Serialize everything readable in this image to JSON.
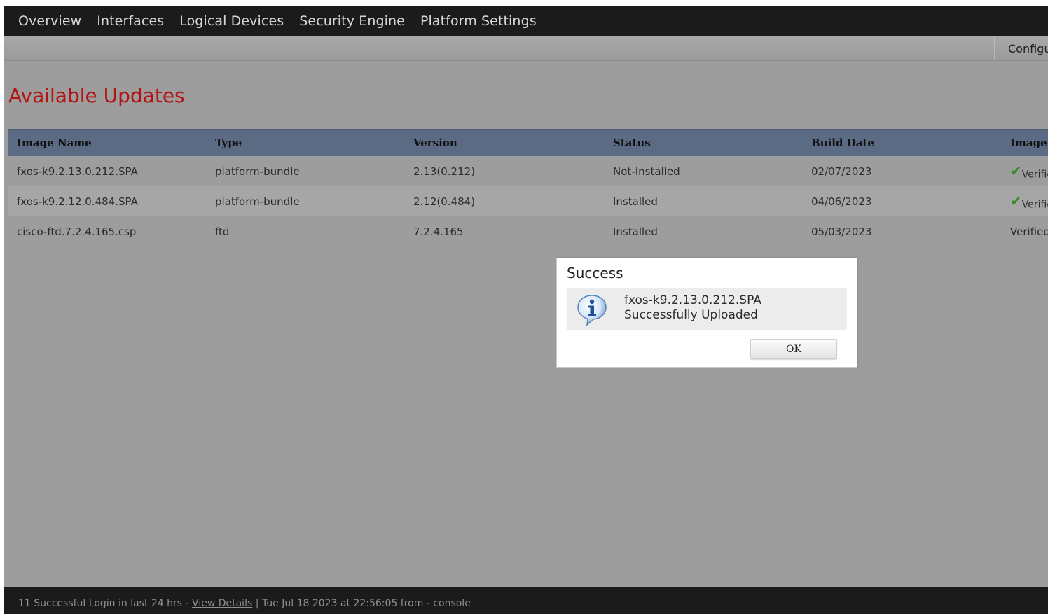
{
  "nav": {
    "items": [
      "Overview",
      "Interfaces",
      "Logical Devices",
      "Security Engine",
      "Platform Settings"
    ]
  },
  "subbar": {
    "config_label": "Configuration"
  },
  "page": {
    "title": "Available Updates"
  },
  "table": {
    "headers": [
      "Image Name",
      "Type",
      "Version",
      "Status",
      "Build Date",
      "Image Integrity"
    ],
    "rows": [
      {
        "image_name": "fxos-k9.2.13.0.212.SPA",
        "type": "platform-bundle",
        "version": "2.13(0.212)",
        "status": "Not-Installed",
        "build_date": "02/07/2023",
        "image_status": "Verified",
        "check": true
      },
      {
        "image_name": "fxos-k9.2.12.0.484.SPA",
        "type": "platform-bundle",
        "version": "2.12(0.484)",
        "status": "Installed",
        "build_date": "04/06/2023",
        "image_status": "Verified",
        "check": true
      },
      {
        "image_name": "cisco-ftd.7.2.4.165.csp",
        "type": "ftd",
        "version": "7.2.4.165",
        "status": "Installed",
        "build_date": "05/03/2023",
        "image_status": "Verified",
        "check": false
      }
    ]
  },
  "dialog": {
    "title": "Success",
    "message_line1": "fxos-k9.2.13.0.212.SPA",
    "message_line2": "Successfully Uploaded",
    "ok_label": "OK",
    "icon": "info-icon"
  },
  "footer": {
    "login_text": "11 Successful Login in last 24 hrs - ",
    "view_details_label": "View Details",
    "session_text": " | Tue Jul 18 2023 at 22:56:05 from - console"
  },
  "colors": {
    "title_red": "#b31313",
    "header_blue": "#5b6b84",
    "check_green": "#3c8c28",
    "nav_bg": "#1b1b1b",
    "content_bg": "#9d9d9d"
  }
}
